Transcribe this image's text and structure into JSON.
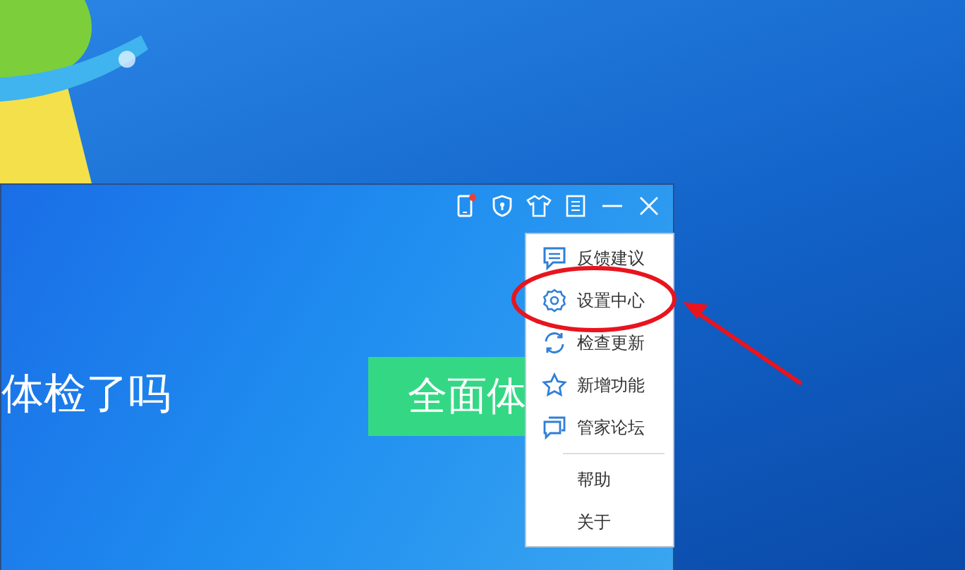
{
  "window": {
    "headline": "体检了吗",
    "scan_button": "全面体"
  },
  "menu": {
    "items": [
      {
        "label": "反馈建议",
        "kind": "chat",
        "circled": false
      },
      {
        "label": "设置中心",
        "kind": "gear",
        "circled": true
      },
      {
        "label": "检查更新",
        "kind": "refresh",
        "circled": false
      },
      {
        "label": "新增功能",
        "kind": "star",
        "circled": false
      },
      {
        "label": "管家论坛",
        "kind": "forum",
        "circled": false
      },
      {
        "label": "帮助",
        "kind": "plain",
        "circled": false
      },
      {
        "label": "关于",
        "kind": "plain",
        "circled": false
      }
    ]
  }
}
